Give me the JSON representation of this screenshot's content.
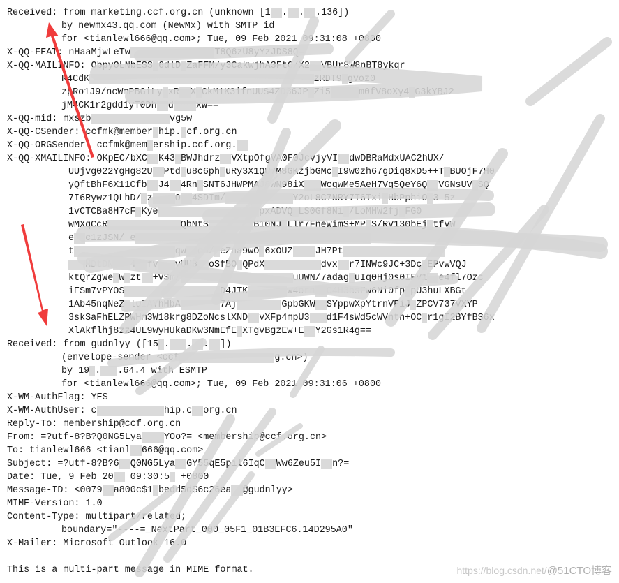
{
  "email_source": {
    "lines": [
      {
        "indent": 0,
        "text": "Received: from marketing.ccf.org.cn (unknown [1██.██.██.136])"
      },
      {
        "indent": 1,
        "text": "by newmx43.qq.com (NewMx) with SMTP id"
      },
      {
        "indent": 1,
        "text": "for <tianlewl666@qq.com>; Tue, 09 Feb 2021 09:31:08 +0800"
      },
      {
        "indent": 0,
        "text": "X-QQ-FEAT: nHaaMjwLeTw███████████████T8Q6zU8yYzJDS8Q="
      },
      {
        "indent": 0,
        "text": "X-QQ-MAILINFO: ObpyOLNbESS█6dlD█ZaFFM/y3CakwjhA3FtC/X2██VBUr8W8nBT8ykqr"
      },
      {
        "indent": 1,
        "text": "R4CdK████████████████████████████████████████zRDT9█gvoz0"
      },
      {
        "indent": 1,
        "text": "zpRo1J9/ncWmPBGiLy█xR██X█CkM1K3ifnUUS4ZD36JP█Zi5█████m0fV8oXy4█G3kYBJ2"
      },
      {
        "indent": 1,
        "text": "jM4CK1r2gdd1yT0Dh██d████xw=="
      },
      {
        "indent": 0,
        "text": "X-QQ-mid: mxszb██████████████vg5w"
      },
      {
        "indent": 0,
        "text": "X-QQ-CSender: ccfmk@member█hip.█cf.org.cn"
      },
      {
        "indent": 0,
        "text": "X-QQ-ORGSender: ccfmk@mem█ership.ccf.org.██"
      },
      {
        "indent": 0,
        "text": "X-QQ-XMAILINFO: OKpEC/bXC██K43█BWJhdrz██VXtpOfgVA0F0JcvjyVI██dwDBRaMdxUAC2hUX/"
      },
      {
        "indent": 2,
        "text": "UUjvg022YgHg82U██Ptd█u8c6ph█uRy3X1QU7M8GKzjbGMc█I9w0zh67gDiq8xD5++T█BUOjF7H0"
      },
      {
        "indent": 2,
        "text": "yQftBhF6X11Cfb██J4██4Rn█SNT6JHWPMAJ8wN98iX███WcgwMe5AeH7Vq5QeY6Q██VGNsUV█SQ"
      },
      {
        "indent": 2,
        "text": "7I6Rywz1QLhD/█z████O██4SDIm/████████████Y2oL8C7NRY7T6Txi█HbPphiO█3 5z"
      },
      {
        "indent": 2,
        "text": "1vCTCBa8H7cF█Kye██████████████████pxADVQ█LS0Gf8Ni█/LoMHW2fj█FG0"
      },
      {
        "indent": 2,
        "text": "wMXqCcR█████████████QbNtS████████B10NJ█Llr7FneWimS+MP█S/RV130bEj█tfvW"
      },
      {
        "indent": 2,
        "text": "e██c1zJSN/ e██████████████████████████████████████████"
      },
      {
        "indent": 2,
        "text": "t██████████████████qw██co/█eZna9wO█6xOUZ████JH7Pt██████████████████"
      },
      {
        "indent": 2,
        "text": "███MDtDN███4██fv███vUU8██oSfBO█QPdX██████████dvx██r7INWc9JC+3Dc█EPvwVQJ"
      },
      {
        "indent": 2,
        "text": "ktQrZgWe█W█zt██+VSm/████████████████████uUWN/7adag█uIq0Hj0s0IFV1██e4fl7Ozc"
      },
      {
        "indent": 2,
        "text": "iESm7vPYOS█████████████████D4JTK███████w4orn██C4H3hsFw6Ni0fp█pU3huLXBGt"
      },
      {
        "indent": 2,
        "text": "1Ab45nqNeZ█luIAYhHbA███████7Aj████████GpbGKW██SYppwXpYtrnVFiJ█ZPCV737VXYP"
      },
      {
        "indent": 2,
        "text": "3skSaFhELZPWHm3W18krg8DZoNcslXND██vXFp4mpU3███d1F4sWd5cWVntn+OC█r1gI2BYfBS6x"
      },
      {
        "indent": 2,
        "text": "XlAkflhj8zz4UL9wyHUkaDKw3NmEfE█XTgvBgzEw+E██Y2Gs1R4g=="
      },
      {
        "indent": 0,
        "text": "Received: from gudnlyy ([15█.███.██.██])"
      },
      {
        "indent": 1,
        "text": "(envelope-sender <ccf█████████████████g.cn>)"
      },
      {
        "indent": 1,
        "text": "by 19█.███.64.4 with ESMTP"
      },
      {
        "indent": 1,
        "text": "for <tianlewl666@qq.com>; Tue, 09 Feb 2021 09:31:06 +0800"
      },
      {
        "indent": 0,
        "text": "X-WM-AuthFlag: YES"
      },
      {
        "indent": 0,
        "text": "X-WM-AuthUser: c████████████hip.c██org.cn"
      },
      {
        "indent": 0,
        "text": "Reply-To: membership@ccf.org.cn"
      },
      {
        "indent": 0,
        "text": "From: =?utf-8?B?Q0NG5Lya████YOo?= <membership@ccf.org.cn>"
      },
      {
        "indent": 0,
        "text": "To: tianlewl666 <tianl██666@qq.com>"
      },
      {
        "indent": 0,
        "text": "Subject: =?utf-8?B?6██Q0NG5Lya██GY55qE5pil6IqC██Ww6Zeu5I██n?="
      },
      {
        "indent": 0,
        "text": "Date: Tue, 9 Feb 20██ 09:30:5█ +0800"
      },
      {
        "indent": 0,
        "text": "Message-ID: <0079██a800c$1█bedd5d$6c26ea██@gudnlyy>"
      },
      {
        "indent": 0,
        "text": "MIME-Version: 1.0"
      },
      {
        "indent": 0,
        "text": "Content-Type: multipart/related;"
      },
      {
        "indent": 1,
        "text": "boundary=\"----=_NextPart_000_05F1_01B3EFC6.14D295A0\""
      },
      {
        "indent": 0,
        "text": "X-Mailer: Microsoft Outlook 16.0"
      },
      {
        "indent": 0,
        "text": ""
      },
      {
        "indent": 0,
        "text": "This is a multi-part message in MIME format."
      }
    ]
  },
  "annotations": {
    "arrow_color": "#f03c3c",
    "redaction_color": "#d7d7d7"
  },
  "watermark": {
    "url": "https://blog.csdn.net/",
    "brand": "@51CTO博客"
  }
}
